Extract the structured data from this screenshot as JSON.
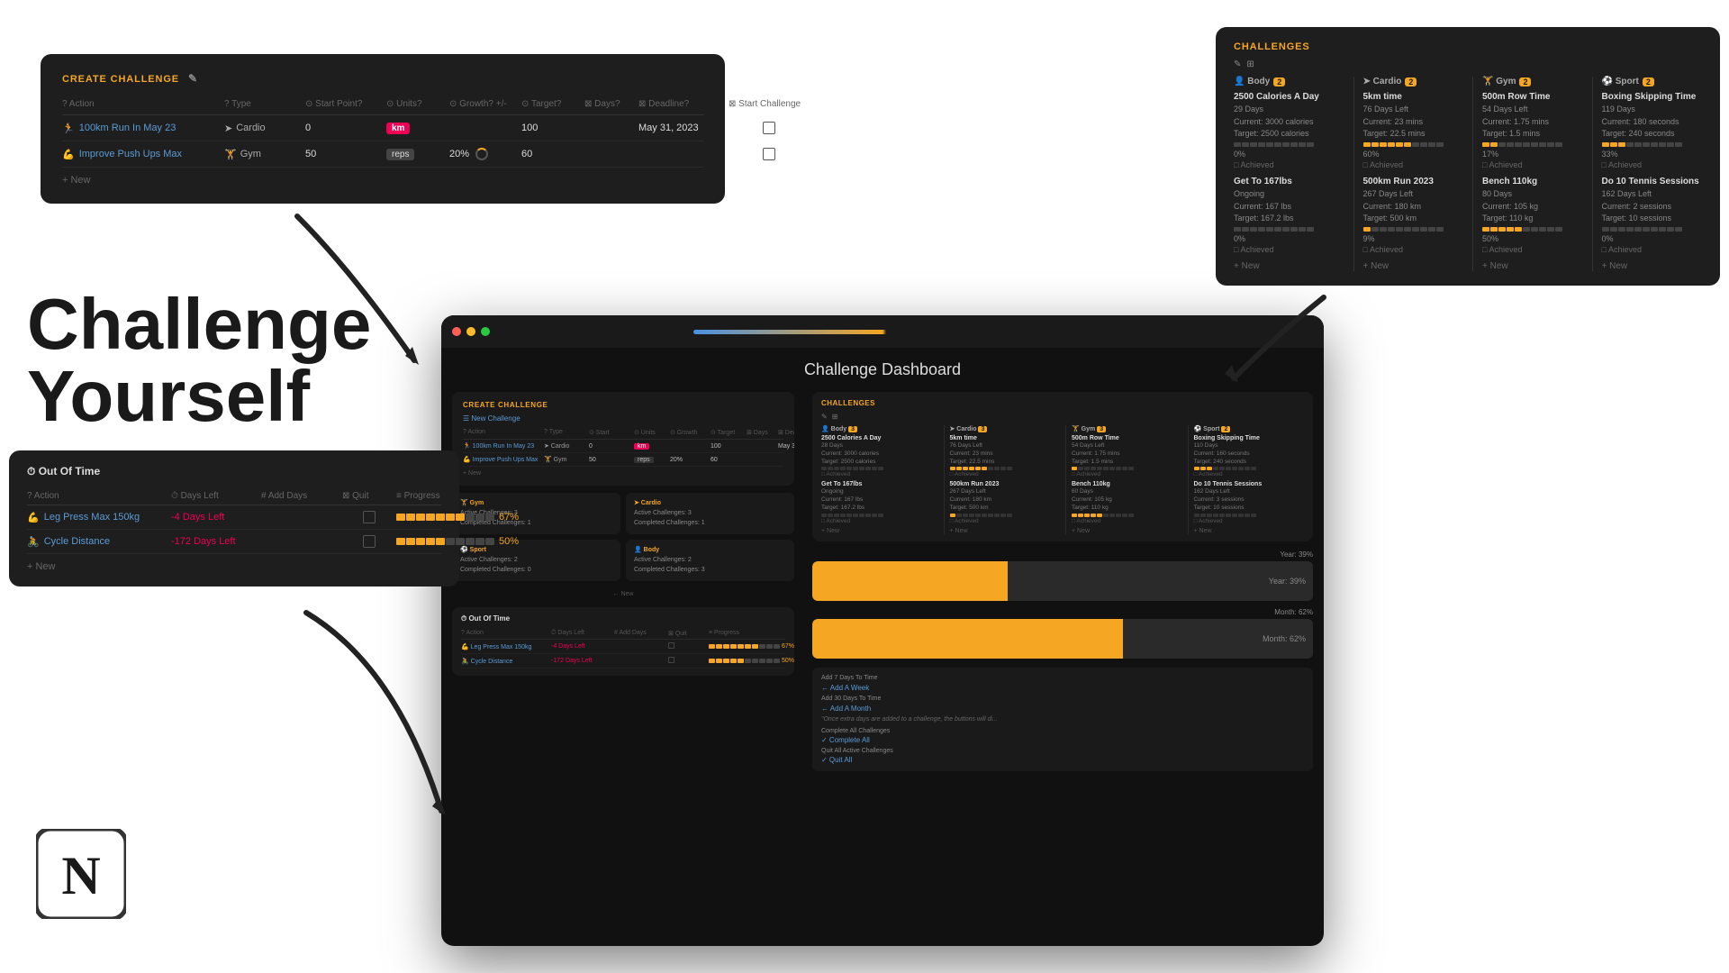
{
  "page": {
    "background": "#ffffff"
  },
  "hero": {
    "line1": "Challenge",
    "line2": "Yourself"
  },
  "notion": {
    "logo_letter": "N"
  },
  "create_challenge_card": {
    "title": "CREATE CHALLENGE",
    "columns": [
      "? Action",
      "? Type",
      "⊙ Start Point?",
      "⊙ Units?",
      "⊙ Growth? +/-",
      "⊙ Target?",
      "⊠ Days?",
      "⊠ Deadline?",
      "⊠ Start Challenge"
    ],
    "rows": [
      {
        "action": "100km Run In May 23",
        "action_icon": "🏃",
        "type": "Cardio",
        "type_icon": "➤",
        "start_point": "0",
        "units": "km",
        "units_color": "red",
        "growth": "",
        "target": "100",
        "days": "",
        "deadline": "May 31, 2023",
        "start": false
      },
      {
        "action": "Improve Push Ups Max",
        "action_icon": "💪",
        "type": "Gym",
        "type_icon": "🏋",
        "start_point": "50",
        "units": "reps",
        "units_color": "dark",
        "growth": "20%",
        "target": "60",
        "days": "",
        "deadline": "",
        "start": false
      }
    ],
    "add_new": "+ New"
  },
  "out_of_time_card": {
    "title": "⏱ Out Of Time",
    "columns": [
      "? Action",
      "⏱ Days Left",
      "# Add Days",
      "⊠ Quit",
      "≡ Progress"
    ],
    "rows": [
      {
        "action": "Leg Press Max 150kg",
        "action_icon": "💪",
        "days_left": "-4 Days Left",
        "add_days": "",
        "quit": false,
        "progress_filled": 7,
        "progress_empty": 3,
        "progress_pct": "67%"
      },
      {
        "action": "Cycle Distance",
        "action_icon": "🚴",
        "days_left": "-172 Days Left",
        "add_days": "",
        "quit": false,
        "progress_filled": 5,
        "progress_empty": 5,
        "progress_pct": "50%"
      }
    ],
    "add_new": "+ New"
  },
  "challenges_card": {
    "title": "CHALLENGES",
    "columns": [
      {
        "name": "Body",
        "count": 2,
        "icon": "👤"
      },
      {
        "name": "Cardio",
        "count": 2,
        "icon": "➤"
      },
      {
        "name": "Gym",
        "count": 2,
        "icon": "💪"
      },
      {
        "name": "Sport",
        "count": 2,
        "icon": "⚽"
      }
    ],
    "body_items": [
      {
        "name": "2500 Calories A Day",
        "days": "29 Days",
        "current_label": "Current: 3000 calories",
        "target_label": "Target: 2500 calories",
        "progress_filled": 0,
        "progress_empty": 10,
        "progress_pct": "0%",
        "achieved": "Achieved"
      },
      {
        "name": "Get To 167lbs",
        "days": "Ongoing",
        "current_label": "Current: 167 lbs",
        "target_label": "Target: 167.2 lbs",
        "progress_filled": 0,
        "progress_empty": 10,
        "progress_pct": "0%",
        "achieved": "Achieved"
      }
    ],
    "cardio_items": [
      {
        "name": "5km time",
        "days": "76 Days Left",
        "current_label": "Current: 23 mins",
        "target_label": "Target: 22.5 mins",
        "progress_filled": 6,
        "progress_empty": 4,
        "progress_pct": "60%",
        "achieved": "Achieved"
      },
      {
        "name": "500km Run 2023",
        "days": "267 Days Left",
        "current_label": "Current: 180 km",
        "target_label": "Target: 500 km",
        "progress_filled": 1,
        "progress_empty": 9,
        "progress_pct": "9%",
        "achieved": "Achieved"
      }
    ],
    "gym_items": [
      {
        "name": "500m Row Time",
        "days": "54 Days Left",
        "current_label": "Current: 1.75 mins",
        "target_label": "Target: 1.5 mins",
        "progress_filled": 2,
        "progress_empty": 8,
        "progress_pct": "17%",
        "achieved": "Achieved"
      },
      {
        "name": "Bench 110kg",
        "days": "80 Days",
        "current_label": "Current: 105 kg",
        "target_label": "Target: 110 kg",
        "progress_filled": 5,
        "progress_empty": 5,
        "progress_pct": "50%",
        "achieved": "Achieved"
      }
    ],
    "sport_items": [
      {
        "name": "Boxing Skipping Time",
        "days": "119 Days",
        "current_label": "Current: 180 seconds",
        "target_label": "Target: 240 seconds",
        "progress_filled": 3,
        "progress_empty": 7,
        "progress_pct": "33%",
        "achieved": "Achieved"
      },
      {
        "name": "Do 10 Tennis Sessions",
        "days": "162 Days Left",
        "current_label": "Current: 2 sessions",
        "target_label": "Target: 10 sessions",
        "progress_filled": 0,
        "progress_empty": 10,
        "progress_pct": "0%",
        "achieved": "Achieved"
      }
    ],
    "add_new": "+ New"
  },
  "dashboard": {
    "title": "Challenge Dashboard",
    "bar1_label": "Year: 39%",
    "bar2_label": "Month: 62%",
    "tips": [
      "Add 7 Days To Time",
      "+ Add A Week",
      "Add 30 Days To Time",
      "+ Add A Month",
      "\"Once extra days are added to a challenge, the buttons will di...",
      "Complete All Challenges",
      "✓ Complete All",
      "Quit All Active Challenges",
      "✓ Quit All"
    ]
  },
  "mini_categories": [
    {
      "title": "🏋 Gym",
      "active": "Active Challenges: 3",
      "completed": "Completed Challenges: 1"
    },
    {
      "title": "➤ Cardio",
      "active": "Active Challenges: 3",
      "completed": "Completed Challenges: 1"
    },
    {
      "title": "⚽ Sport",
      "active": "Active Challenges: 2",
      "completed": "Completed Challenges: 0"
    },
    {
      "title": "👤 Body",
      "active": "Active Challenges: 2",
      "completed": "Completed Challenges: 3"
    }
  ]
}
